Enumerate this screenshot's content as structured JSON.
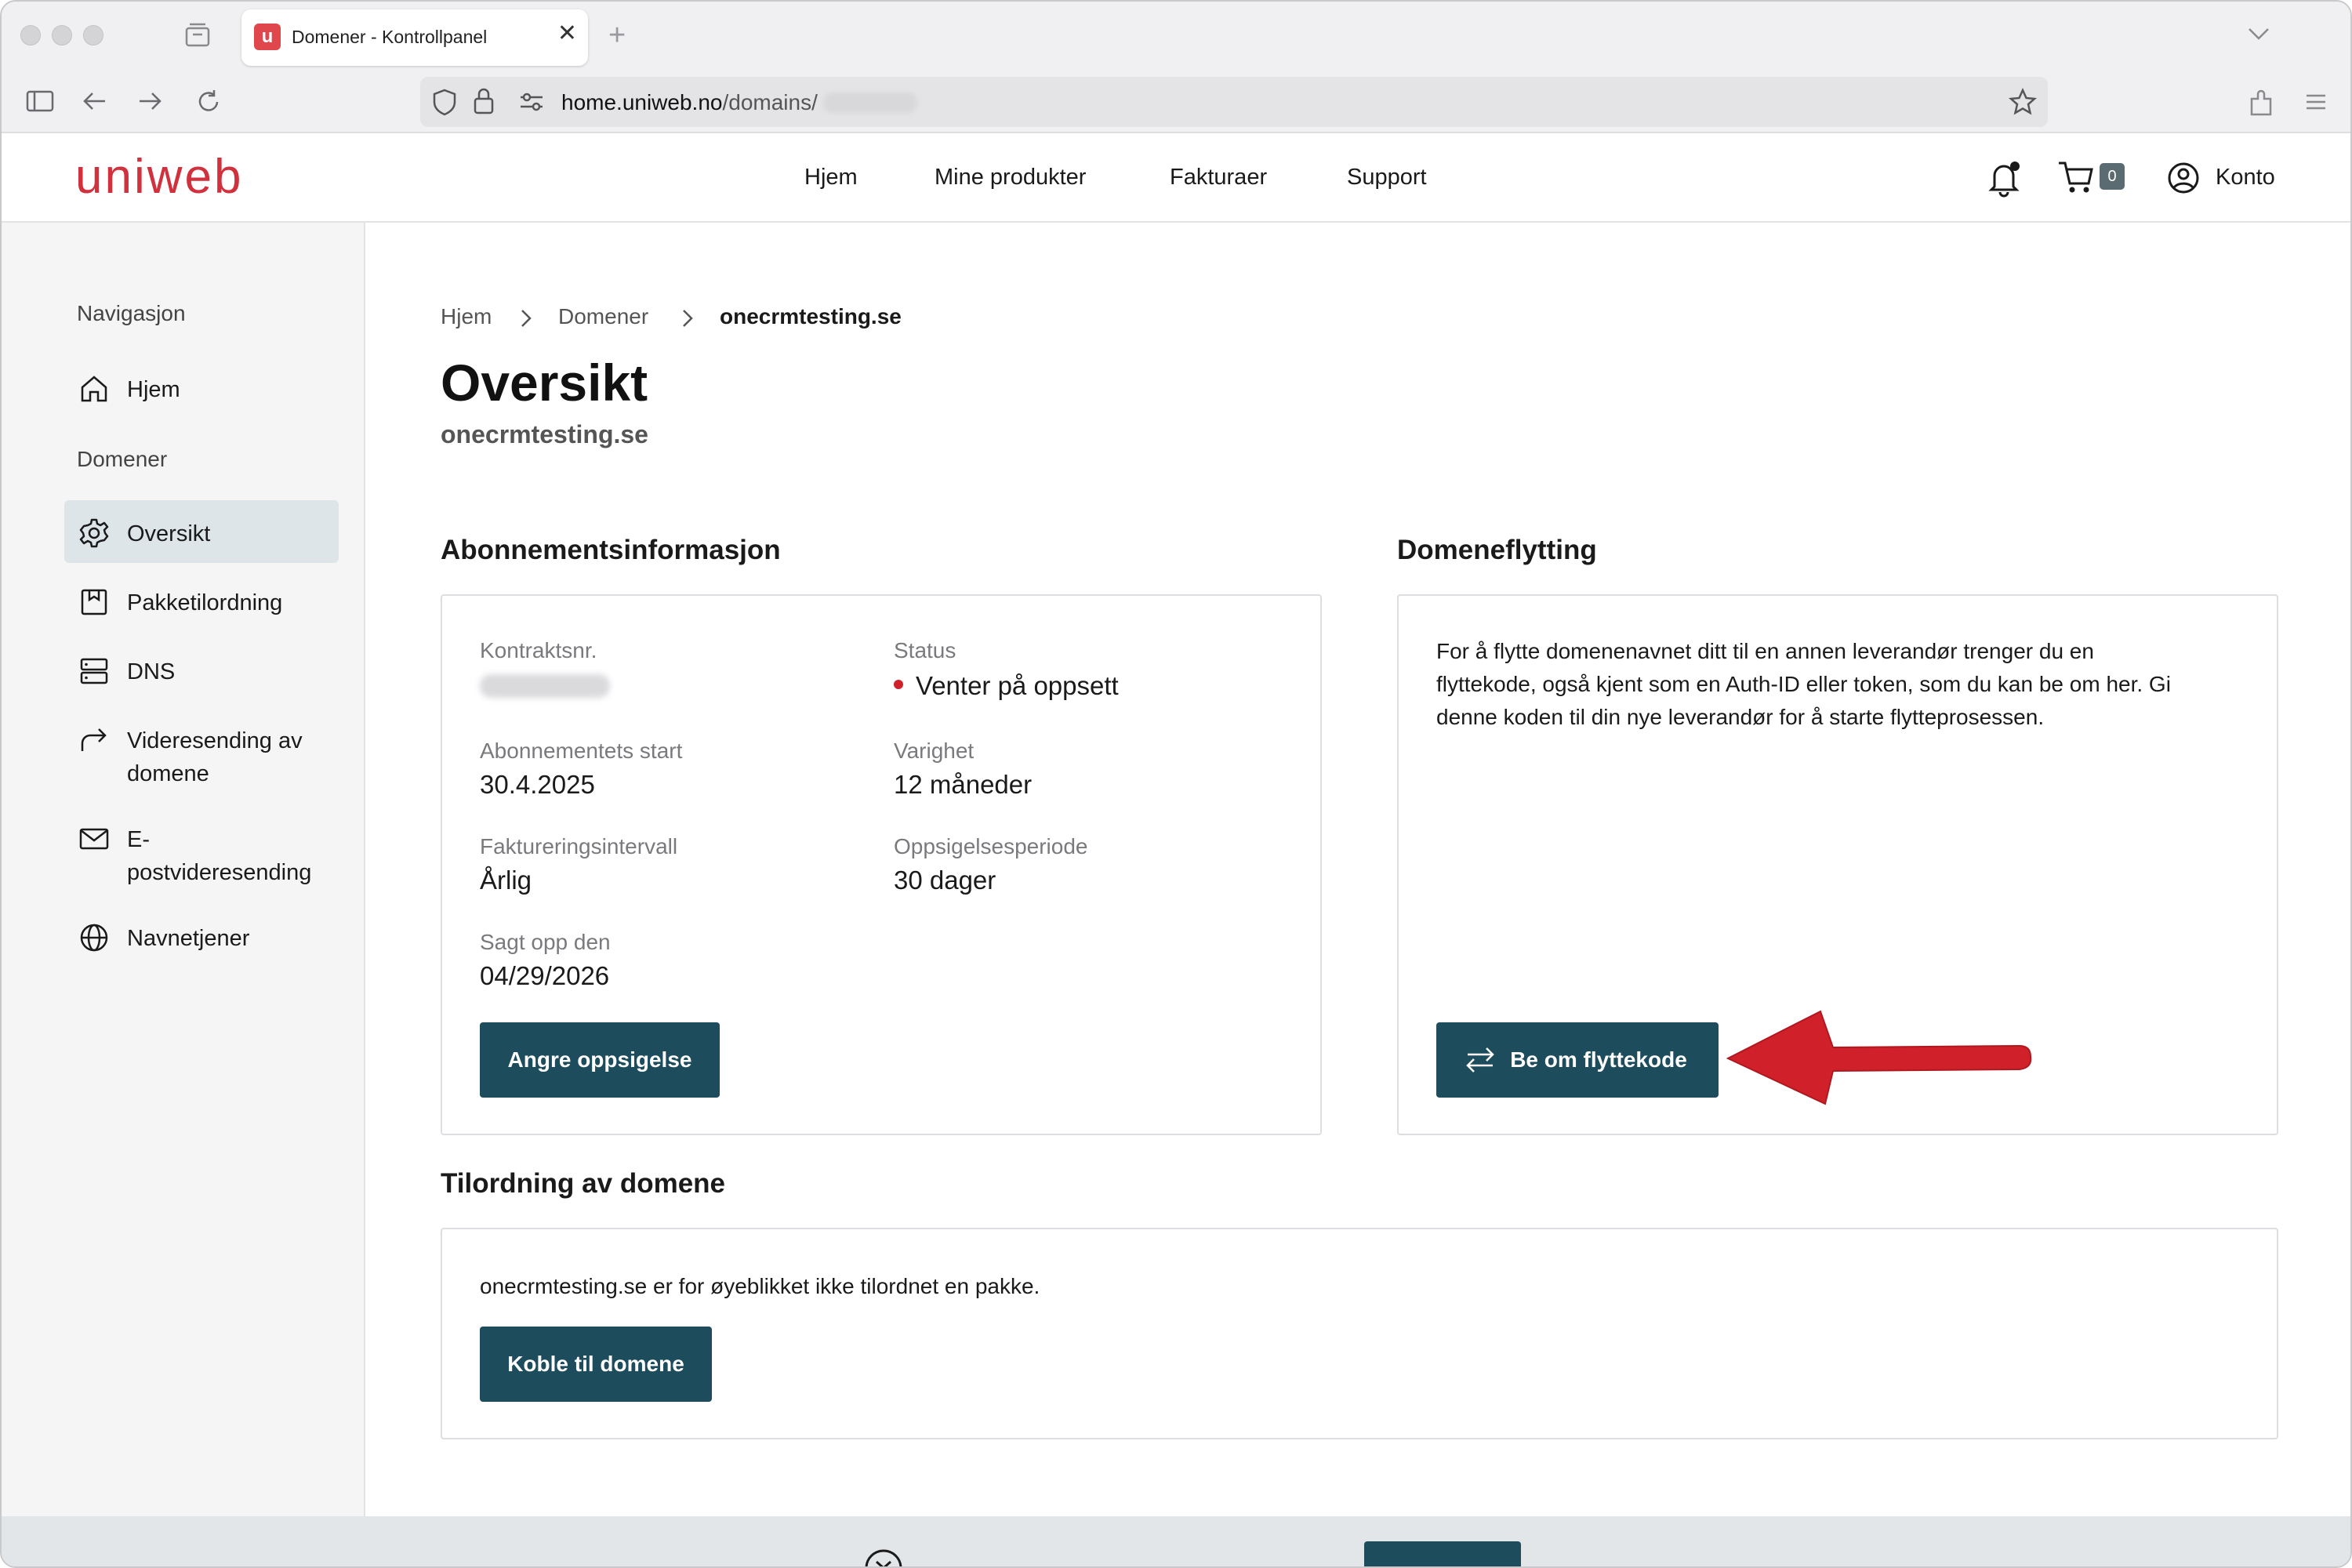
{
  "browser": {
    "tab_title": "Domener - Kontrollpanel",
    "tab_favicon": "u",
    "url_host": "home.uniweb.no",
    "url_path": "/domains/",
    "icons": [
      "sidebar-toggle-icon",
      "back-icon",
      "forward-icon",
      "reload-icon",
      "shield-icon",
      "lock-icon",
      "tune-icon",
      "star-icon",
      "extensions-icon",
      "menu-icon"
    ]
  },
  "header": {
    "logo": "uniweb",
    "nav": [
      "Hjem",
      "Mine produkter",
      "Fakturaer",
      "Support"
    ],
    "cart_count": "0",
    "account_label": "Konto",
    "brand_color": "#d0313d"
  },
  "sidebar": {
    "nav_heading": "Navigasjon",
    "home_label": "Hjem",
    "domains_heading": "Domener",
    "items": [
      {
        "label": "Oversikt",
        "icon": "gear-icon"
      },
      {
        "label": "Pakketilordning",
        "icon": "package-icon"
      },
      {
        "label": "DNS",
        "icon": "server-icon"
      },
      {
        "label": "Videresending av",
        "label2": "domene",
        "icon": "forward-arrow-icon"
      },
      {
        "label": "E-",
        "label2": "postvideresending",
        "icon": "mail-icon"
      },
      {
        "label": "Navnetjener",
        "icon": "globe-icon"
      }
    ]
  },
  "breadcrumb": [
    "Hjem",
    "Domener",
    "onecrmtesting.se"
  ],
  "page": {
    "title": "Oversikt",
    "subtitle": "onecrmtesting.se"
  },
  "subscription": {
    "title": "Abonnementsinformasjon",
    "contract_label": "Kontraktsnr.",
    "status_label": "Status",
    "status_value": "Venter på oppsett",
    "start_label": "Abonnementets start",
    "start_value": "30.4.2025",
    "duration_label": "Varighet",
    "duration_value": "12 måneder",
    "billing_label": "Faktureringsintervall",
    "billing_value": "Årlig",
    "notice_label": "Oppsigelsesperiode",
    "notice_value": "30 dager",
    "cancelled_label": "Sagt opp den",
    "cancelled_value": "04/29/2026",
    "undo_button": "Angre oppsigelse"
  },
  "transfer": {
    "title": "Domeneflytting",
    "line1": "For å flytte domenenavnet ditt til en annen leverandør trenger du en",
    "line2": "flyttekode, også kjent som en Auth-ID eller token, som du kan be om her. Gi",
    "line3": "denne koden til din nye leverandør for å starte flytteprosessen.",
    "button": "Be om flyttekode"
  },
  "assignment": {
    "title": "Tilordning av domene",
    "text": "onecrmtesting.se er for øyeblikket ikke tilordnet en pakke.",
    "button": "Koble til domene"
  },
  "colors": {
    "button": "#1d4c5d",
    "arrow": "#d0202a",
    "status_dot": "#d0202a"
  }
}
